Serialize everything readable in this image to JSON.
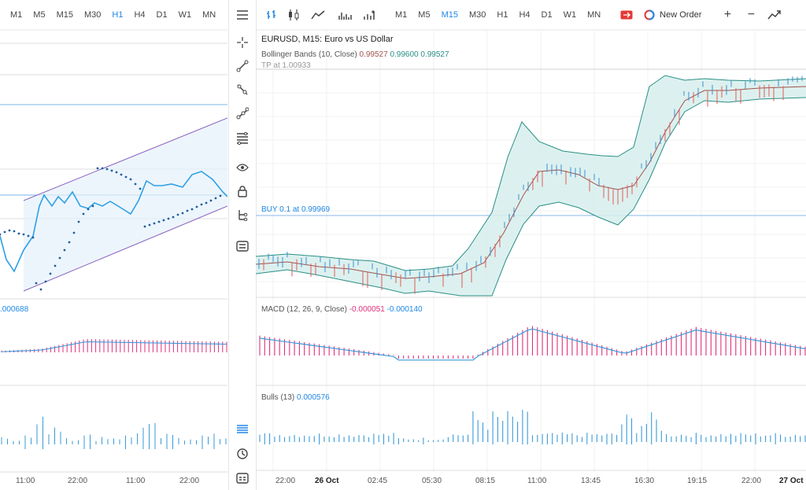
{
  "left_panel": {
    "timeframes": [
      "M1",
      "M5",
      "M15",
      "M30",
      "H1",
      "H4",
      "D1",
      "W1",
      "MN"
    ],
    "active_timeframe": "H1",
    "macd_value": ".000688",
    "time_labels": [
      "11:00",
      "22:00",
      "11:00",
      "22:00"
    ]
  },
  "sidebar": {
    "icons": [
      "menu-icon",
      "crosshair-icon",
      "trendline-icon",
      "ray-icon",
      "channel-icon",
      "fibonacci-icon",
      "eye-icon",
      "lock-icon",
      "tree-icon",
      "layers-icon",
      "list-icon",
      "history-icon",
      "calendar-icon"
    ]
  },
  "toolbar": {
    "chart_types": [
      "bar-chart-icon",
      "candlestick-icon",
      "line-chart-icon",
      "volume-icon",
      "indicators-icon"
    ],
    "timeframes": [
      "M1",
      "M5",
      "M15",
      "M30",
      "H1",
      "H4",
      "D1",
      "W1",
      "MN"
    ],
    "active_timeframe": "M15",
    "new_order_label": "New Order",
    "zoom_in": "+",
    "zoom_out": "−"
  },
  "chart": {
    "symbol_title": "EURUSD, M15: Euro vs US Dollar",
    "bb_label": "Bollinger Bands (10, Close)",
    "bb_values": [
      "0.99527",
      "0.99600",
      "0.99527"
    ],
    "tp_label": "TP at 1.00933",
    "buy_label": "BUY 0.1 at 0.99969",
    "macd_label": "MACD (12, 26, 9, Close)",
    "macd_values": [
      "-0.000051",
      "-0.000140"
    ],
    "bulls_label": "Bulls (13)",
    "bulls_value": "0.000576",
    "time_labels": [
      "22:00",
      "26 Oct",
      "02:45",
      "05:30",
      "08:15",
      "11:00",
      "13:45",
      "16:30",
      "19:15",
      "22:00",
      "27 Oct"
    ]
  },
  "colors": {
    "accent": "#1e88e5",
    "bollinger_fill": "#d6efec",
    "bollinger_line": "#2a8f86",
    "middle_band": "#a0534f",
    "macd_hist": "#e0307a",
    "signal_line": "#3a9ad9",
    "bulls_bar": "#3a9ad9",
    "channel": "#8a62c0"
  }
}
